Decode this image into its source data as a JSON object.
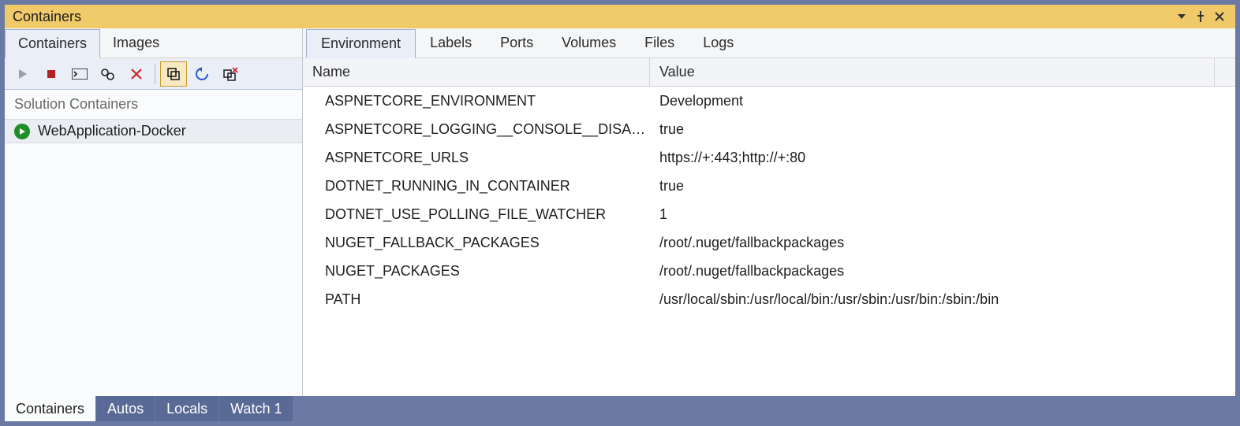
{
  "title": "Containers",
  "left": {
    "tabs": [
      "Containers",
      "Images"
    ],
    "active_tab": 0,
    "group_header": "Solution Containers",
    "containers": [
      {
        "name": "WebApplication-Docker",
        "running": true
      }
    ]
  },
  "right": {
    "tabs": [
      "Environment",
      "Labels",
      "Ports",
      "Volumes",
      "Files",
      "Logs"
    ],
    "active_tab": 0,
    "columns": [
      "Name",
      "Value"
    ],
    "rows": [
      {
        "name": "ASPNETCORE_ENVIRONMENT",
        "value": "Development"
      },
      {
        "name": "ASPNETCORE_LOGGING__CONSOLE__DISA…",
        "value": "true"
      },
      {
        "name": "ASPNETCORE_URLS",
        "value": "https://+:443;http://+:80"
      },
      {
        "name": "DOTNET_RUNNING_IN_CONTAINER",
        "value": "true"
      },
      {
        "name": "DOTNET_USE_POLLING_FILE_WATCHER",
        "value": "1"
      },
      {
        "name": "NUGET_FALLBACK_PACKAGES",
        "value": "/root/.nuget/fallbackpackages"
      },
      {
        "name": "NUGET_PACKAGES",
        "value": "/root/.nuget/fallbackpackages"
      },
      {
        "name": "PATH",
        "value": "/usr/local/sbin:/usr/local/bin:/usr/sbin:/usr/bin:/sbin:/bin"
      }
    ]
  },
  "bottom_tabs": {
    "items": [
      "Containers",
      "Autos",
      "Locals",
      "Watch 1"
    ],
    "active": 0
  },
  "toolbar_icons": [
    "play",
    "stop",
    "terminal",
    "settings",
    "delete",
    "copy",
    "refresh",
    "prune"
  ]
}
